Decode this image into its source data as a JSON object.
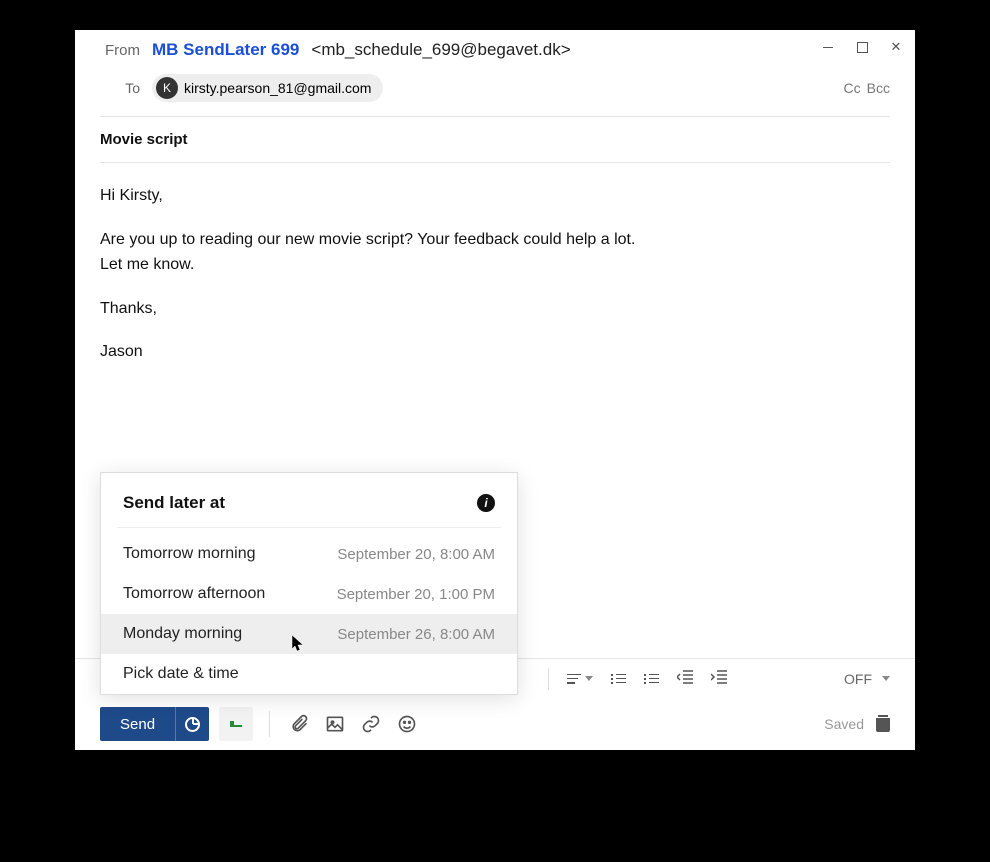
{
  "header": {
    "from_label": "From",
    "from_name": "MB SendLater 699",
    "from_addr": "<mb_schedule_699@begavet.dk>",
    "to_label": "To",
    "recipient_email": "kirsty.pearson_81@gmail.com",
    "recipient_initial": "K",
    "cc_label": "Cc",
    "bcc_label": "Bcc"
  },
  "subject": "Movie script",
  "body": {
    "greeting": "Hi Kirsty,",
    "para": "Are you up to reading our new movie script? Your feedback could help a lot.\nLet me know.",
    "thanks": "Thanks,",
    "signature": "Jason"
  },
  "popup": {
    "title": "Send later at",
    "items": [
      {
        "label": "Tomorrow morning",
        "time": "September 20, 8:00 AM"
      },
      {
        "label": "Tomorrow afternoon",
        "time": "September 20, 1:00 PM"
      },
      {
        "label": "Monday morning",
        "time": "September 26, 8:00 AM"
      },
      {
        "label": "Pick date & time",
        "time": ""
      }
    ]
  },
  "toolbar": {
    "tracking_label": "OFF"
  },
  "actions": {
    "send_label": "Send",
    "saved_label": "Saved"
  }
}
